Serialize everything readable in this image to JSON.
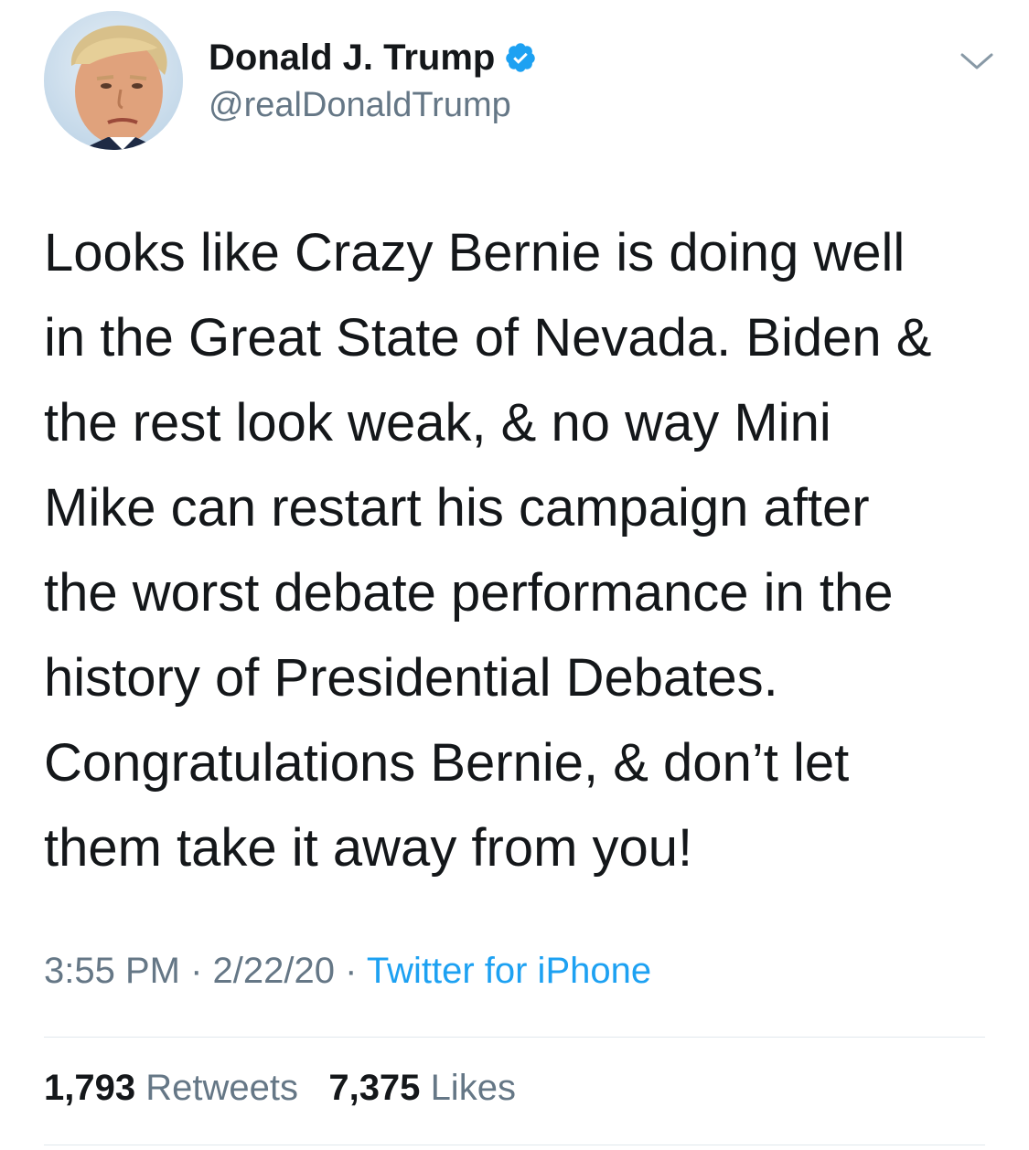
{
  "author": {
    "display_name": "Donald J. Trump",
    "handle": "@realDonaldTrump",
    "verified": true,
    "avatar_icon": "profile-photo"
  },
  "tweet": {
    "text": "Looks like Crazy Bernie is doing well\nin the Great State of Nevada. Biden &\nthe rest look weak, & no way Mini\nMike can restart his campaign after\nthe worst debate performance in the\nhistory of Presidential Debates.\nCongratulations Bernie, & don’t let\nthem take it away from you!",
    "time": "3:55 PM",
    "separator": "·",
    "date": "2/22/20",
    "source": "Twitter for iPhone"
  },
  "stats": {
    "retweets_count": "1,793",
    "retweets_label": "Retweets",
    "likes_count": "7,375",
    "likes_label": "Likes"
  },
  "colors": {
    "text": "#14171a",
    "secondary": "#657786",
    "accent": "#1da1f2",
    "divider": "#e1e8ed"
  },
  "icons": {
    "verified": "verified-badge-icon",
    "menu": "chevron-down-icon"
  }
}
